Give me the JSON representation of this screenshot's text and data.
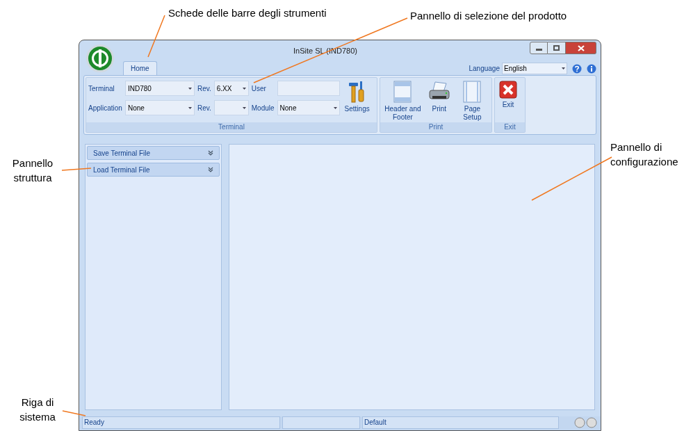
{
  "annotations": [
    {
      "text": "Schede delle barre degli strumenti"
    },
    {
      "text": "Pannello di selezione del prodotto"
    },
    {
      "text": "Pannello struttura"
    },
    {
      "text": "Pannello di configurazione"
    },
    {
      "text": "Riga di sistema"
    }
  ],
  "window": {
    "title": "InSite SL (IND780)"
  },
  "tabs": [
    {
      "label": "Home",
      "selected": true
    }
  ],
  "language": {
    "label": "Language",
    "value": "English"
  },
  "ribbon": {
    "groups": [
      {
        "title": "Terminal",
        "fields": [
          {
            "label": "Terminal",
            "kind": "combo",
            "value": "IND780"
          },
          {
            "label": "Rev.",
            "kind": "combo",
            "value": "6.XX"
          },
          {
            "label": "User",
            "kind": "text"
          },
          {
            "label": "Application",
            "kind": "combo",
            "value": "None"
          },
          {
            "label": "Rev.",
            "kind": "combo"
          },
          {
            "label": "Module",
            "kind": "combo",
            "value": "None"
          }
        ],
        "buttons": [
          {
            "label": "Settings",
            "kind": "settings"
          }
        ]
      },
      {
        "title": "Print",
        "buttons": [
          {
            "label": "Header and Footer",
            "kind": "header-footer"
          },
          {
            "label": "Print",
            "kind": "print"
          },
          {
            "label": "Page Setup",
            "kind": "page-setup"
          }
        ]
      },
      {
        "title": "Exit",
        "buttons": [
          {
            "label": "Exit",
            "kind": "exit"
          }
        ]
      }
    ]
  },
  "sidebar": {
    "items": [
      {
        "label": "Save Terminal File",
        "expanded": false
      },
      {
        "label": "Load Terminal File",
        "expanded": false
      }
    ]
  },
  "status_bar": {
    "cells": [
      "Ready",
      "",
      "Default"
    ]
  }
}
